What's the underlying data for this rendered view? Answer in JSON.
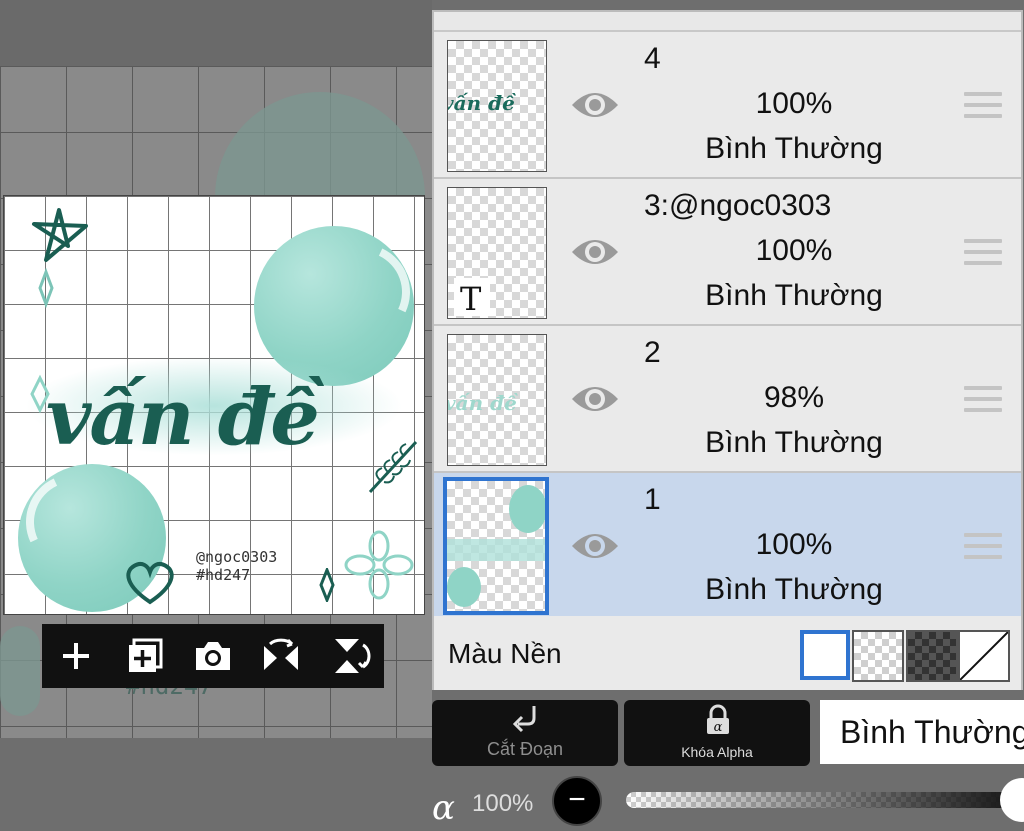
{
  "canvas": {
    "title_art": "vấn đề",
    "signature_line1": "@ngoc0303",
    "signature_line2": "#hd247",
    "ghost_text": "#hd247"
  },
  "toolbar": {
    "items": [
      {
        "name": "add-layer-button",
        "icon": "plus-icon"
      },
      {
        "name": "duplicate-layer-button",
        "icon": "add-copy-icon"
      },
      {
        "name": "camera-button",
        "icon": "camera-icon"
      },
      {
        "name": "flip-horizontal-button",
        "icon": "flip-horizontal-icon"
      },
      {
        "name": "flip-vertical-button",
        "icon": "flip-vertical-icon"
      }
    ]
  },
  "layers": [
    {
      "name": "4",
      "opacity": "100%",
      "blend": "Bình Thường",
      "selected": false,
      "thumb_text": "vấn đề"
    },
    {
      "name": "3:@ngoc0303",
      "opacity": "100%",
      "blend": "Bình Thường",
      "selected": false,
      "thumb_text": "T"
    },
    {
      "name": "2",
      "opacity": "98%",
      "blend": "Bình Thường",
      "selected": false,
      "thumb_text": "vấn đề"
    },
    {
      "name": "1",
      "opacity": "100%",
      "blend": "Bình Thường",
      "selected": true,
      "thumb_text": ""
    }
  ],
  "background": {
    "label": "Màu Nền",
    "selected": "white",
    "options": [
      "white",
      "transparent",
      "dark-checker",
      "none"
    ]
  },
  "actions": {
    "clip_label": "Cắt Đoạn",
    "alpha_lock_label": "Khóa Alpha",
    "blend_mode": "Bình Thường"
  },
  "opacity": {
    "symbol": "α",
    "value": "100%",
    "fraction": 1.0
  },
  "colors": {
    "accent": "#2f74d0",
    "selected_row": "#c8d7ec",
    "art_teal": "#1a5e52",
    "bubble_mint": "#8fd4c6"
  }
}
